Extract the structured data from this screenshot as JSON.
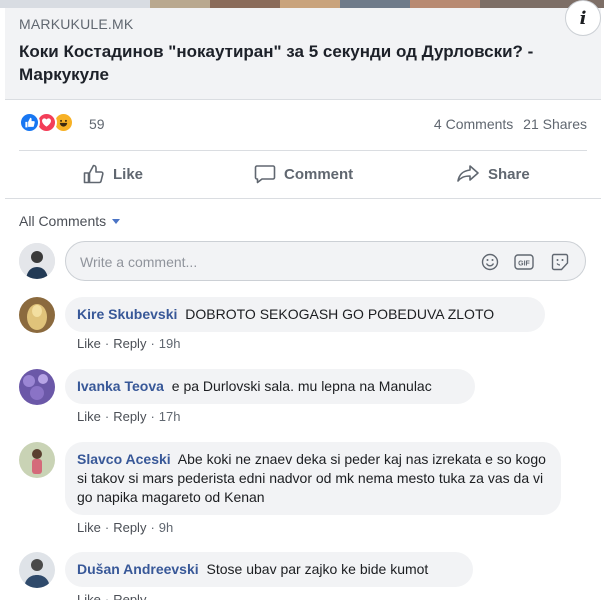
{
  "link_preview": {
    "domain": "MARKUKULE.MK",
    "headline": "Коки Костадинов \"нокаутиран\" за 5 секунди од Дурловски? - Маркукуле",
    "info_glyph": "i"
  },
  "reactions": {
    "icons": [
      "like-icon",
      "love-icon",
      "haha-icon"
    ],
    "count": "59",
    "comments_count": "4 Comments",
    "shares_count": "21 Shares"
  },
  "actions": {
    "like": "Like",
    "comment": "Comment",
    "share": "Share"
  },
  "comments_filter": {
    "label": "All Comments"
  },
  "composer": {
    "placeholder": "Write a comment..."
  },
  "comments": [
    {
      "author": "Kire Skubevski",
      "text": "DOBROTO SEKOGASH GO POBEDUVA ZLOTO",
      "like": "Like",
      "reply": "Reply",
      "time": "19h"
    },
    {
      "author": "Ivanka Teova",
      "text": "e pa Durlovski sala. mu lepna na Manulac",
      "like": "Like",
      "reply": "Reply",
      "time": "17h"
    },
    {
      "author": "Slavco Aceski",
      "text": "Abe koki ne znaev deka si peder kaj nas izrekata e so kogo si takov si mars pederista edni nadvor od mk nema mesto tuka za vas da vi go napika magareto od Kenan",
      "like": "Like",
      "reply": "Reply",
      "time": "9h"
    },
    {
      "author": "Dušan Andreevski",
      "text": "Stose ubav par zajko ke bide kumot",
      "like": "Like",
      "reply": "Reply",
      "time": ""
    }
  ],
  "colors": {
    "link_blue": "#385898",
    "meta_gray": "#606770",
    "bubble_bg": "#f2f3f5",
    "like_blue": "#1877f2",
    "love_red": "#f33e58",
    "haha_yellow": "#f7b125"
  }
}
